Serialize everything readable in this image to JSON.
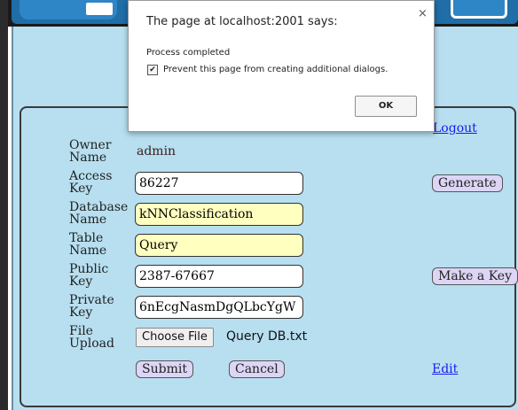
{
  "dialog": {
    "title": "The page at localhost:2001 says:",
    "close": "×",
    "message": "Process completed",
    "checkbox_checked": "✔",
    "checkbox_label": "Prevent this page from creating additional dialogs.",
    "ok_label": "OK"
  },
  "header": {
    "logout_label": "Logout"
  },
  "form": {
    "owner": {
      "label_line1": "Owner",
      "label_line2": "Name",
      "value": "admin"
    },
    "access_key": {
      "label_line1": "Access",
      "label_line2": "Key",
      "value": "86227",
      "generate_label": "Generate"
    },
    "database": {
      "label_line1": "Database",
      "label_line2": "Name",
      "value": "kNNClassification"
    },
    "table": {
      "label_line1": "Table",
      "label_line2": "Name",
      "value": "Query"
    },
    "public_key": {
      "label_line1": "Public",
      "label_line2": "Key",
      "value": "2387-67667",
      "make_key_label": "Make a Key"
    },
    "private_key": {
      "label_line1": "Private",
      "label_line2": "Key",
      "value": "6nEcgNasmDgQLbcYgW"
    },
    "file": {
      "label_line1": "File",
      "label_line2": "Upload",
      "choose_label": "Choose File",
      "file_name": "Query DB.txt"
    },
    "submit_label": "Submit",
    "cancel_label": "Cancel",
    "edit_label": "Edit"
  },
  "colors": {
    "page_background": "#b7dff0",
    "banner_blue": "#1f6ea7",
    "button_background": "#ddd5f5",
    "highlight_field": "#ffffc0",
    "link": "#1a1aee"
  }
}
